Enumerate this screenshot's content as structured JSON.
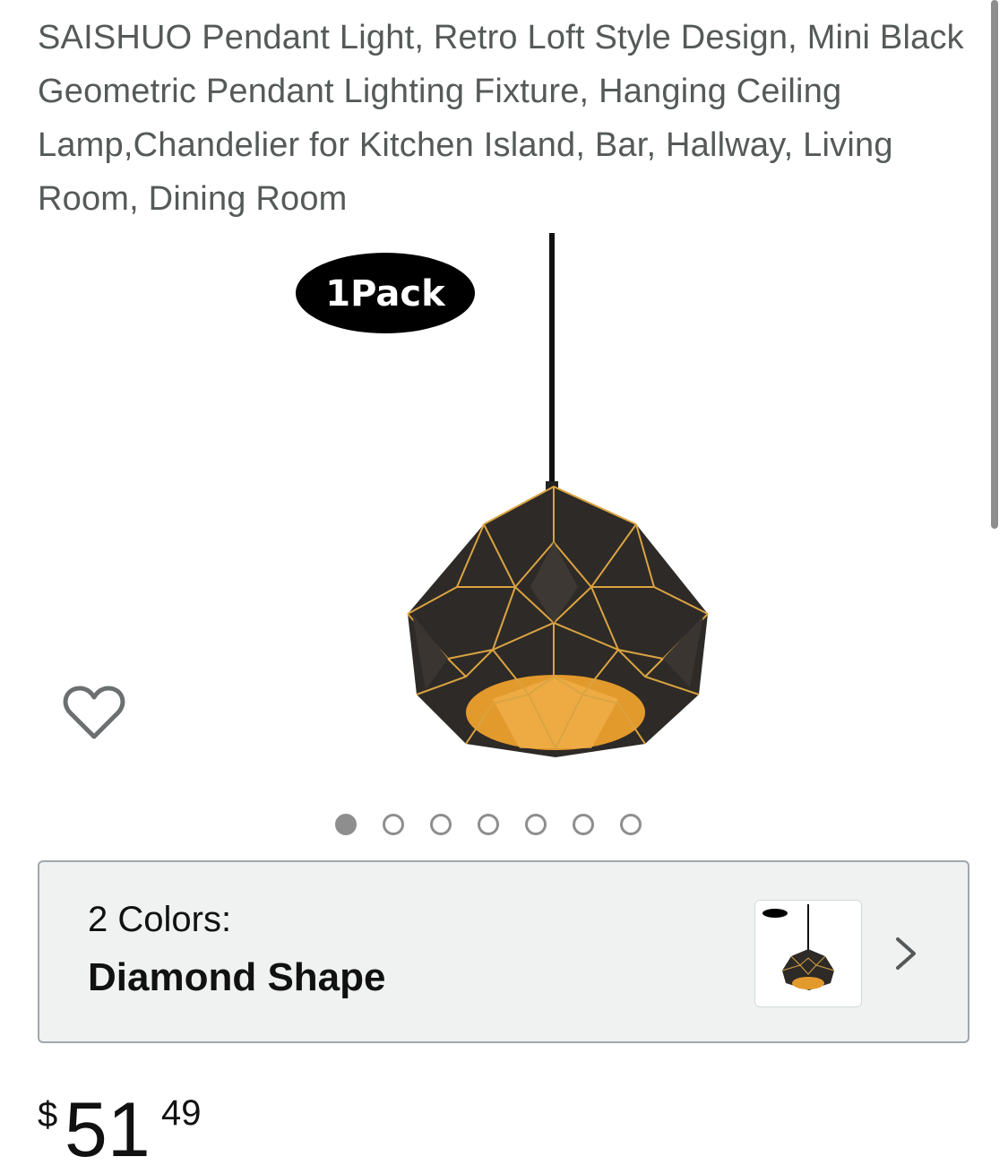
{
  "product": {
    "title": "SAISHUO Pendant Light, Retro Loft Style Design, Mini Black Geometric Pendant Lighting Fixture, Hanging Ceiling Lamp,Chandelier for Kitchen Island, Bar, Hallway, Living Room, Dining Room",
    "image_badge": "1Pack",
    "image_count": 7,
    "active_image_index": 0
  },
  "icons": {
    "wishlist": "heart-outline-icon",
    "variant_next": "chevron-right-icon"
  },
  "variant": {
    "label": "2 Colors:",
    "value": "Diamond Shape"
  },
  "price": {
    "symbol": "$",
    "whole": "51",
    "fraction": "49"
  },
  "colors": {
    "shade": "#2e2a27",
    "gold": "#d9a441",
    "inner_gold": "#e39a2c",
    "muted_text": "#565959"
  }
}
